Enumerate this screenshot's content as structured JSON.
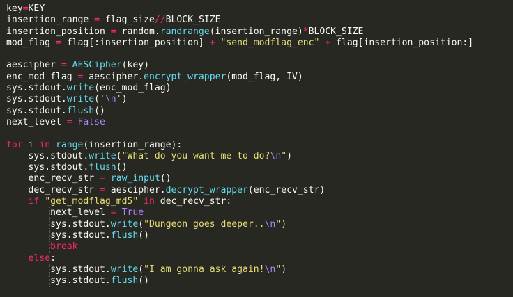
{
  "editor": {
    "language": "python",
    "theme": "monokai",
    "colors": {
      "background": "#272822",
      "default": "#f8f8f2",
      "keyword": "#f92672",
      "operator": "#f92672",
      "function": "#66d9ef",
      "string": "#e6db74",
      "constant": "#ae81ff"
    },
    "lines": [
      {
        "indent": 0,
        "tokens": [
          {
            "t": "key",
            "c": "default"
          },
          {
            "t": "=",
            "c": "op"
          },
          {
            "t": "KEY",
            "c": "default"
          }
        ]
      },
      {
        "indent": 0,
        "tokens": [
          {
            "t": "insertion_range ",
            "c": "default"
          },
          {
            "t": "=",
            "c": "op"
          },
          {
            "t": " flag_size",
            "c": "default"
          },
          {
            "t": "//",
            "c": "op"
          },
          {
            "t": "BLOCK_SIZE",
            "c": "default"
          }
        ]
      },
      {
        "indent": 0,
        "tokens": [
          {
            "t": "insertion_position ",
            "c": "default"
          },
          {
            "t": "=",
            "c": "op"
          },
          {
            "t": " random.",
            "c": "default"
          },
          {
            "t": "randrange",
            "c": "call"
          },
          {
            "t": "(insertion_range)",
            "c": "default"
          },
          {
            "t": "*",
            "c": "op"
          },
          {
            "t": "BLOCK_SIZE",
            "c": "default"
          }
        ]
      },
      {
        "indent": 0,
        "tokens": [
          {
            "t": "mod_flag ",
            "c": "default"
          },
          {
            "t": "=",
            "c": "op"
          },
          {
            "t": " flag[:insertion_position] ",
            "c": "default"
          },
          {
            "t": "+",
            "c": "op"
          },
          {
            "t": " ",
            "c": "default"
          },
          {
            "t": "\"send_modflag_enc\"",
            "c": "str"
          },
          {
            "t": " ",
            "c": "default"
          },
          {
            "t": "+",
            "c": "op"
          },
          {
            "t": " flag[insertion_position:]",
            "c": "default"
          }
        ]
      },
      {
        "indent": 0,
        "tokens": []
      },
      {
        "indent": 0,
        "tokens": [
          {
            "t": "aescipher ",
            "c": "default"
          },
          {
            "t": "=",
            "c": "op"
          },
          {
            "t": " ",
            "c": "default"
          },
          {
            "t": "AESCipher",
            "c": "call"
          },
          {
            "t": "(key)",
            "c": "default"
          }
        ]
      },
      {
        "indent": 0,
        "tokens": [
          {
            "t": "enc_mod_flag ",
            "c": "default"
          },
          {
            "t": "=",
            "c": "op"
          },
          {
            "t": " aescipher.",
            "c": "default"
          },
          {
            "t": "encrypt_wrapper",
            "c": "call"
          },
          {
            "t": "(mod_flag, IV)",
            "c": "default"
          }
        ]
      },
      {
        "indent": 0,
        "tokens": [
          {
            "t": "sys.stdout.",
            "c": "default"
          },
          {
            "t": "write",
            "c": "call"
          },
          {
            "t": "(enc_mod_flag)",
            "c": "default"
          }
        ]
      },
      {
        "indent": 0,
        "tokens": [
          {
            "t": "sys.stdout.",
            "c": "default"
          },
          {
            "t": "write",
            "c": "call"
          },
          {
            "t": "(",
            "c": "default"
          },
          {
            "t": "'",
            "c": "str"
          },
          {
            "t": "\\n",
            "c": "esc"
          },
          {
            "t": "'",
            "c": "str"
          },
          {
            "t": ")",
            "c": "default"
          }
        ]
      },
      {
        "indent": 0,
        "tokens": [
          {
            "t": "sys.stdout.",
            "c": "default"
          },
          {
            "t": "flush",
            "c": "call"
          },
          {
            "t": "()",
            "c": "default"
          }
        ]
      },
      {
        "indent": 0,
        "tokens": [
          {
            "t": "next_level ",
            "c": "default"
          },
          {
            "t": "=",
            "c": "op"
          },
          {
            "t": " ",
            "c": "default"
          },
          {
            "t": "False",
            "c": "const"
          }
        ]
      },
      {
        "indent": 0,
        "tokens": []
      },
      {
        "indent": 0,
        "tokens": [
          {
            "t": "for",
            "c": "kw"
          },
          {
            "t": " i ",
            "c": "default"
          },
          {
            "t": "in",
            "c": "kw"
          },
          {
            "t": " ",
            "c": "default"
          },
          {
            "t": "range",
            "c": "call"
          },
          {
            "t": "(insertion_range):",
            "c": "default"
          }
        ]
      },
      {
        "indent": 1,
        "tokens": [
          {
            "t": "sys.stdout.",
            "c": "default"
          },
          {
            "t": "write",
            "c": "call"
          },
          {
            "t": "(",
            "c": "default"
          },
          {
            "t": "\"What do you want me to do?",
            "c": "str"
          },
          {
            "t": "\\n",
            "c": "esc"
          },
          {
            "t": "\"",
            "c": "str"
          },
          {
            "t": ")",
            "c": "default"
          }
        ]
      },
      {
        "indent": 1,
        "tokens": [
          {
            "t": "sys.stdout.",
            "c": "default"
          },
          {
            "t": "flush",
            "c": "call"
          },
          {
            "t": "()",
            "c": "default"
          }
        ]
      },
      {
        "indent": 1,
        "tokens": [
          {
            "t": "enc_recv_str ",
            "c": "default"
          },
          {
            "t": "=",
            "c": "op"
          },
          {
            "t": " ",
            "c": "default"
          },
          {
            "t": "raw_input",
            "c": "call"
          },
          {
            "t": "()",
            "c": "default"
          }
        ]
      },
      {
        "indent": 1,
        "tokens": [
          {
            "t": "dec_recv_str ",
            "c": "default"
          },
          {
            "t": "=",
            "c": "op"
          },
          {
            "t": " aescipher.",
            "c": "default"
          },
          {
            "t": "decrypt_wrapper",
            "c": "call"
          },
          {
            "t": "(enc_recv_str)",
            "c": "default"
          }
        ]
      },
      {
        "indent": 1,
        "tokens": [
          {
            "t": "if",
            "c": "kw"
          },
          {
            "t": " ",
            "c": "default"
          },
          {
            "t": "\"get_modflag_md5\"",
            "c": "str"
          },
          {
            "t": " ",
            "c": "default"
          },
          {
            "t": "in",
            "c": "kw"
          },
          {
            "t": " dec_recv_str:",
            "c": "default"
          }
        ]
      },
      {
        "indent": 2,
        "tokens": [
          {
            "t": "next_level ",
            "c": "default"
          },
          {
            "t": "=",
            "c": "op"
          },
          {
            "t": " ",
            "c": "default"
          },
          {
            "t": "True",
            "c": "const"
          }
        ]
      },
      {
        "indent": 2,
        "tokens": [
          {
            "t": "sys.stdout.",
            "c": "default"
          },
          {
            "t": "write",
            "c": "call"
          },
          {
            "t": "(",
            "c": "default"
          },
          {
            "t": "\"Dungeon goes deeper..",
            "c": "str"
          },
          {
            "t": "\\n",
            "c": "esc"
          },
          {
            "t": "\"",
            "c": "str"
          },
          {
            "t": ")",
            "c": "default"
          }
        ]
      },
      {
        "indent": 2,
        "tokens": [
          {
            "t": "sys.stdout.",
            "c": "default"
          },
          {
            "t": "flush",
            "c": "call"
          },
          {
            "t": "()",
            "c": "default"
          }
        ]
      },
      {
        "indent": 2,
        "tokens": [
          {
            "t": "break",
            "c": "kw"
          }
        ]
      },
      {
        "indent": 1,
        "tokens": [
          {
            "t": "else",
            "c": "kw"
          },
          {
            "t": ":",
            "c": "default"
          }
        ]
      },
      {
        "indent": 2,
        "tokens": [
          {
            "t": "sys.stdout.",
            "c": "default"
          },
          {
            "t": "write",
            "c": "call"
          },
          {
            "t": "(",
            "c": "default"
          },
          {
            "t": "\"I am gonna ask again!",
            "c": "str"
          },
          {
            "t": "\\n",
            "c": "esc"
          },
          {
            "t": "\"",
            "c": "str"
          },
          {
            "t": ")",
            "c": "default"
          }
        ]
      },
      {
        "indent": 2,
        "tokens": [
          {
            "t": "sys.stdout.",
            "c": "default"
          },
          {
            "t": "flush",
            "c": "call"
          },
          {
            "t": "()",
            "c": "default"
          }
        ]
      }
    ]
  }
}
